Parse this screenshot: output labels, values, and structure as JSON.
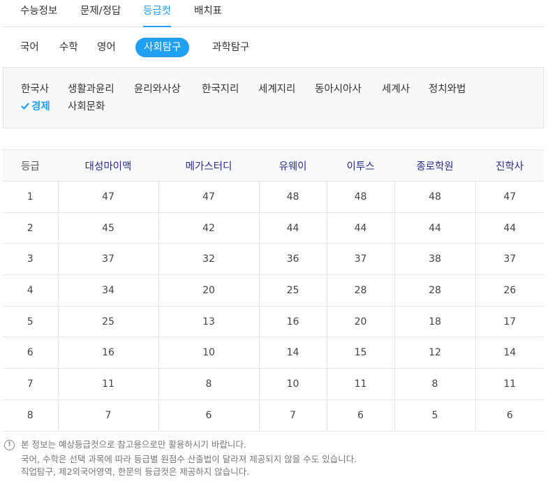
{
  "top_tabs": [
    "수능정보",
    "문제/정답",
    "등급컷",
    "배치표"
  ],
  "active_top_tab": "등급컷",
  "subjects": [
    "국어",
    "수학",
    "영어",
    "사회탐구",
    "과학탐구"
  ],
  "active_subject": "사회탐구",
  "sub_subjects": [
    "한국사",
    "생활과윤리",
    "윤리와사상",
    "한국지리",
    "세계지리",
    "동아시아사",
    "세계사",
    "정치와법",
    "경제",
    "사회문화"
  ],
  "active_sub_subject": "경제",
  "table": {
    "grade_header": "등급",
    "providers": [
      "대성마이맥",
      "메가스터디",
      "유웨이",
      "이투스",
      "종로학원",
      "진학사"
    ],
    "rows": [
      {
        "grade": "1",
        "values": [
          "47",
          "47",
          "48",
          "48",
          "48",
          "47"
        ]
      },
      {
        "grade": "2",
        "values": [
          "45",
          "42",
          "44",
          "44",
          "44",
          "44"
        ]
      },
      {
        "grade": "3",
        "values": [
          "37",
          "32",
          "36",
          "37",
          "38",
          "37"
        ]
      },
      {
        "grade": "4",
        "values": [
          "34",
          "20",
          "25",
          "28",
          "28",
          "26"
        ]
      },
      {
        "grade": "5",
        "values": [
          "25",
          "13",
          "16",
          "20",
          "18",
          "17"
        ]
      },
      {
        "grade": "6",
        "values": [
          "16",
          "10",
          "14",
          "15",
          "12",
          "14"
        ]
      },
      {
        "grade": "7",
        "values": [
          "11",
          "8",
          "10",
          "11",
          "8",
          "11"
        ]
      },
      {
        "grade": "8",
        "values": [
          "7",
          "6",
          "7",
          "6",
          "5",
          "6"
        ]
      }
    ]
  },
  "notice": {
    "icon": "exclamation-circle-icon",
    "icon_glyph": "!",
    "lines": [
      "본 정보는 예상등급컷으로 참고용으로만 활용하시기 바랍니다.",
      "국어, 수학은 선택 과목에 따라 등급별 원점수 산출법이 달라져 제공되지 않을 수도 있습니다.",
      "직업탐구, 제2외국어영역, 한문의 등급컷은 제공하지 않습니다."
    ]
  },
  "colors": {
    "accent": "#1f9ff0",
    "header_text": "#2a2a8c"
  }
}
